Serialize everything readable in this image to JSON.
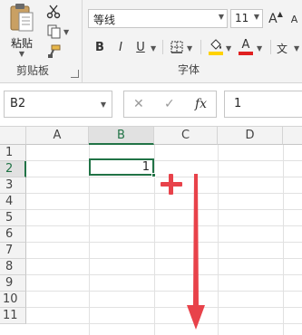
{
  "ribbon": {
    "clipboard": {
      "paste_label": "粘贴",
      "group_label": "剪贴板",
      "icons": [
        "paste-icon",
        "cut-icon",
        "copy-icon",
        "format-painter-icon"
      ]
    },
    "font": {
      "font_name": "等线",
      "font_size": "11",
      "bold": "B",
      "italic": "I",
      "underline": "U",
      "grow_font": "A",
      "shrink_font": "A",
      "font_color_letter": "A",
      "group_label": "字体",
      "fill_color": "#ffd200",
      "font_color": "#e02020"
    }
  },
  "formula_bar": {
    "name_box": "B2",
    "fx_label": "fx",
    "content": "1"
  },
  "sheet": {
    "columns": [
      "A",
      "B",
      "C",
      "D"
    ],
    "rows": [
      "1",
      "2",
      "3",
      "4",
      "5",
      "6",
      "7",
      "8",
      "9",
      "10",
      "11"
    ],
    "selected_column": "B",
    "selected_row": "2",
    "active_cell_value": "1",
    "accent": "#217346",
    "annotation_color": "#e8424a"
  }
}
